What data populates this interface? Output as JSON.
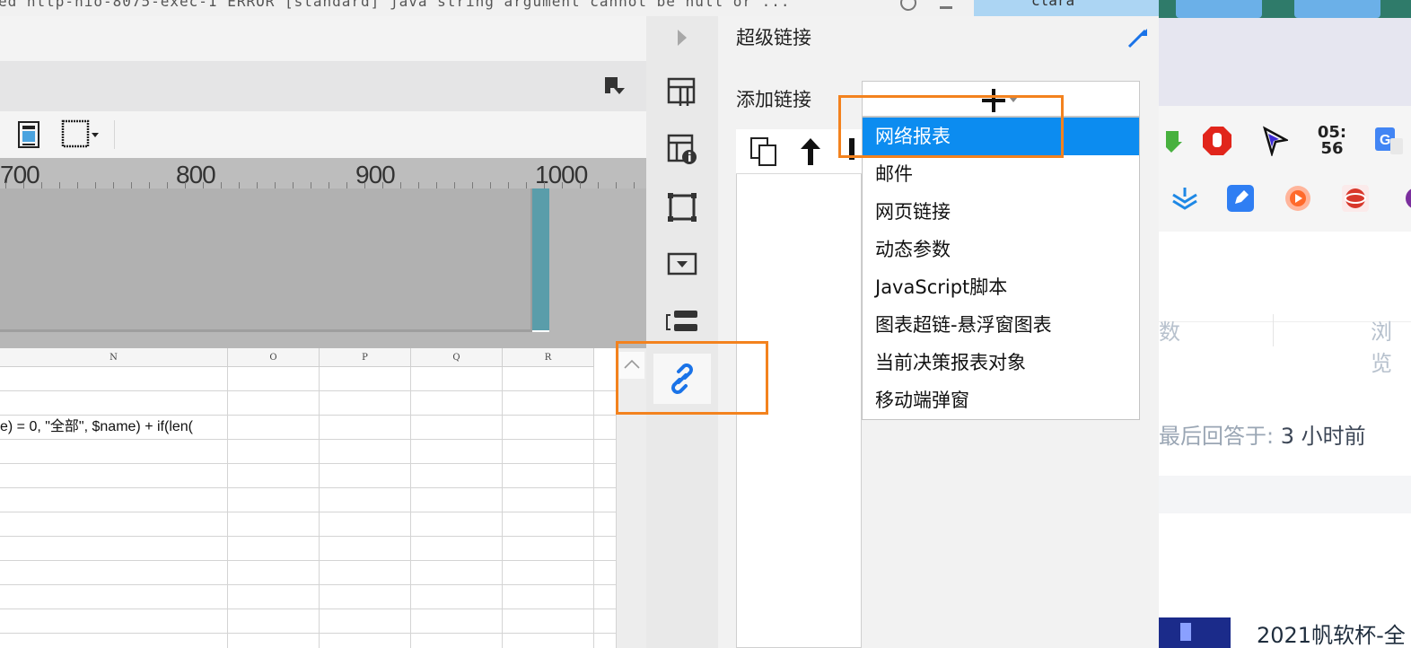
{
  "top_strip": {
    "text": "ed http-nio-8075-exec-1 ERROR [standard] java string argument cannot be null or ...",
    "tab_text": "clara"
  },
  "ruler": {
    "labels": [
      "700",
      "800",
      "900",
      "1000"
    ]
  },
  "sheet": {
    "columns": [
      "N",
      "O",
      "P",
      "Q",
      "R"
    ],
    "formula_cell": "e) = 0, \"全部\", $name) + if(len("
  },
  "panel": {
    "title": "超级链接",
    "add_label": "添加链接",
    "menu": [
      "网络报表",
      "邮件",
      "网页链接",
      "动态参数",
      "JavaScript脚本",
      "图表超链-悬浮窗图表",
      "当前决策报表对象",
      "移动端弹窗"
    ],
    "selected_index": 0
  },
  "browser": {
    "clock": "05:\n56",
    "col_left": "数",
    "col_right": "浏览",
    "answered_label": "最后回答于:",
    "answered_value": "3 小时前",
    "contest_title": "2021帆软杯-全"
  },
  "colors": {
    "accent_blue": "#0c8cf0",
    "highlight_orange": "#f3821e",
    "link_icon_blue": "#1a73e8"
  },
  "icons": {
    "band_menu": "dropdown-menu-icon",
    "image_tool": "image-icon",
    "border_tool": "border-icon",
    "collapse": "chevron-right-icon",
    "cell_attr": "cell-attribute-icon",
    "cell_info": "cell-info-icon",
    "widget": "widget-frame-icon",
    "dropdown_widget": "dropdown-widget-icon",
    "condition": "condition-format-icon",
    "hyperlink": "hyperlink-icon",
    "pin": "pin-icon",
    "copy": "copy-icon",
    "up": "arrow-up-icon",
    "down": "arrow-down-icon",
    "add": "plus-icon"
  }
}
